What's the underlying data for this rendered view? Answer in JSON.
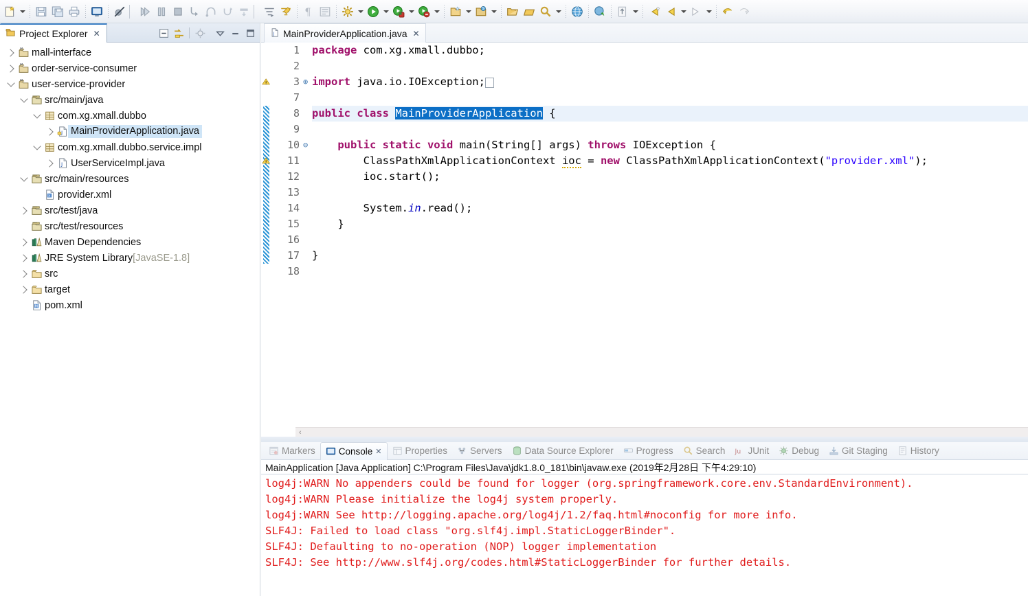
{
  "toolbar": {
    "groups": [
      {
        "name": "new",
        "icons": [
          "new-wizard-icon"
        ],
        "arrow": true
      },
      {
        "sep": true
      },
      {
        "name": "file",
        "icons": [
          "save-icon",
          "save-all-icon",
          "print-icon"
        ]
      },
      {
        "sep": true
      },
      {
        "name": "console-view",
        "icons": [
          "open-console-icon"
        ]
      },
      {
        "sep": true
      },
      {
        "name": "skip-breakpoints",
        "icons": [
          "skip-all-breakpoints-icon"
        ]
      },
      {
        "sep2": true
      },
      {
        "name": "debug-controls",
        "icons": [
          "resume-icon",
          "suspend-icon",
          "terminate-icon",
          "step-into-icon",
          "step-over-icon",
          "step-return-icon",
          "drop-to-frame-icon"
        ]
      },
      {
        "sep2": true
      },
      {
        "name": "step-filters",
        "icons": [
          "step-filters-icon",
          "use-step-filters-icon"
        ]
      },
      {
        "sep": true
      },
      {
        "name": "markers",
        "icons": [
          "pilcrow-icon",
          "show-whitespace-icon"
        ]
      },
      {
        "sep": true
      },
      {
        "name": "external-tools",
        "icons": [
          "external-tools-icon"
        ],
        "arrow": true
      },
      {
        "name": "run",
        "icons": [
          "run-icon"
        ],
        "arrow": true
      },
      {
        "name": "debug",
        "icons": [
          "debug-icon"
        ],
        "arrow": true
      },
      {
        "name": "coverage",
        "icons": [
          "coverage-icon"
        ],
        "arrow": true
      },
      {
        "sep": true
      },
      {
        "name": "new-java-package",
        "icons": [
          "new-java-package-icon"
        ],
        "arrow": true
      },
      {
        "name": "new-class",
        "icons": [
          "new-class-icon"
        ],
        "arrow": true
      },
      {
        "sep": true
      },
      {
        "name": "open-type",
        "icons": [
          "open-type-icon"
        ]
      },
      {
        "name": "open-task",
        "icons": [
          "open-task-icon"
        ]
      },
      {
        "name": "search",
        "icons": [
          "search-icon"
        ],
        "arrow": true
      },
      {
        "sep": true
      },
      {
        "name": "web-browser",
        "icons": [
          "web-browser-icon"
        ]
      },
      {
        "sep": true
      },
      {
        "name": "run-last-tool",
        "icons": [
          "run-last-tool-icon"
        ]
      },
      {
        "sep": true
      },
      {
        "name": "previous-annotation",
        "icons": [
          "previous-annotation-icon"
        ],
        "arrow": true
      },
      {
        "sep": true
      },
      {
        "name": "next-edit",
        "icons": [
          "next-edit-icon"
        ]
      },
      {
        "name": "back",
        "icons": [
          "back-icon"
        ],
        "arrow": true
      },
      {
        "name": "forward",
        "icons": [
          "forward-icon"
        ],
        "arrow": true
      },
      {
        "sep": true
      },
      {
        "name": "undo-nav",
        "icons": [
          "undo-nav-icon"
        ]
      },
      {
        "name": "redo-nav",
        "icons": [
          "redo-nav-icon"
        ]
      }
    ]
  },
  "explorer": {
    "tab_title": "Project Explorer",
    "close_glyph": "✕",
    "tools": [
      {
        "name": "collapse-all-icon",
        "title": "Collapse All"
      },
      {
        "name": "link-with-editor-icon",
        "title": "Link with Editor"
      },
      {
        "name": "focus-on-active-task-icon",
        "title": "Focus on Active Task"
      },
      {
        "name": "view-menu-icon",
        "title": "View Menu"
      },
      {
        "name": "minimize-icon",
        "title": "Minimize"
      },
      {
        "name": "maximize-icon",
        "title": "Maximize"
      }
    ],
    "tree": [
      {
        "label": "mall-interface",
        "indent": 0,
        "twist": "right",
        "icon": "maven-project-icon",
        "selected": false
      },
      {
        "label": "order-service-consumer",
        "indent": 0,
        "twist": "right",
        "icon": "maven-project-icon",
        "selected": false
      },
      {
        "label": "user-service-provider",
        "indent": 0,
        "twist": "down",
        "icon": "maven-project-icon",
        "selected": false
      },
      {
        "label": "src/main/java",
        "indent": 1,
        "twist": "down",
        "icon": "source-folder-icon",
        "selected": false
      },
      {
        "label": "com.xg.xmall.dubbo",
        "indent": 2,
        "twist": "down",
        "icon": "package-icon",
        "selected": false
      },
      {
        "label": "MainProviderApplication.java",
        "indent": 3,
        "twist": "right",
        "icon": "java-class-icon",
        "selected": true
      },
      {
        "label": "com.xg.xmall.dubbo.service.impl",
        "indent": 2,
        "twist": "down",
        "icon": "package-icon",
        "selected": false
      },
      {
        "label": "UserServiceImpl.java",
        "indent": 3,
        "twist": "right",
        "icon": "java-file-icon",
        "selected": false
      },
      {
        "label": "src/main/resources",
        "indent": 1,
        "twist": "down",
        "icon": "source-folder-icon",
        "selected": false
      },
      {
        "label": "provider.xml",
        "indent": 2,
        "twist": "none",
        "icon": "xml-file-icon",
        "selected": false
      },
      {
        "label": "src/test/java",
        "indent": 1,
        "twist": "right",
        "icon": "source-folder-icon",
        "selected": false
      },
      {
        "label": "src/test/resources",
        "indent": 1,
        "twist": "none",
        "icon": "source-folder-icon",
        "selected": false
      },
      {
        "label": "Maven Dependencies",
        "indent": 1,
        "twist": "right",
        "icon": "library-icon",
        "selected": false
      },
      {
        "label": "JRE System Library",
        "indent": 1,
        "twist": "right",
        "icon": "library-icon",
        "selected": false,
        "suffix": "[JavaSE-1.8]"
      },
      {
        "label": "src",
        "indent": 1,
        "twist": "right",
        "icon": "folder-icon",
        "selected": false
      },
      {
        "label": "target",
        "indent": 1,
        "twist": "right",
        "icon": "folder-icon",
        "selected": false
      },
      {
        "label": "pom.xml",
        "indent": 1,
        "twist": "none",
        "icon": "maven-pom-icon",
        "selected": false
      }
    ]
  },
  "editor": {
    "tab": {
      "title": "MainProviderApplication.java",
      "icon": "java-class-icon",
      "close_glyph": "✕",
      "dirty": false
    },
    "scroll_left_glyph": "‹",
    "lines": [
      {
        "num": "1",
        "fold": "",
        "marker": "",
        "changed": false,
        "highlight": false,
        "tokens": [
          {
            "t": "package ",
            "c": "kw"
          },
          {
            "t": "com.xg.xmall.dubbo;",
            "c": ""
          }
        ]
      },
      {
        "num": "2",
        "fold": "",
        "marker": "",
        "changed": false,
        "highlight": false,
        "tokens": []
      },
      {
        "num": "3",
        "fold": "⊕",
        "marker": "warning",
        "changed": false,
        "highlight": false,
        "tokens": [
          {
            "t": "import ",
            "c": "kw"
          },
          {
            "t": "java.io.IOException;",
            "c": ""
          },
          {
            "t": "▯",
            "c": "folded"
          }
        ]
      },
      {
        "num": "7",
        "fold": "",
        "marker": "",
        "changed": false,
        "highlight": false,
        "tokens": []
      },
      {
        "num": "8",
        "fold": "",
        "marker": "",
        "changed": true,
        "highlight": true,
        "tokens": [
          {
            "t": "public class ",
            "c": "kw"
          },
          {
            "t": "MainProviderApplication",
            "c": "sel"
          },
          {
            "t": " {",
            "c": ""
          }
        ]
      },
      {
        "num": "9",
        "fold": "",
        "marker": "",
        "changed": true,
        "highlight": false,
        "tokens": []
      },
      {
        "num": "10",
        "fold": "⊖",
        "marker": "",
        "changed": true,
        "highlight": false,
        "tokens": [
          {
            "t": "    public static void ",
            "c": "kw"
          },
          {
            "t": "main(String[] args) ",
            "c": ""
          },
          {
            "t": "throws ",
            "c": "kw"
          },
          {
            "t": "IOException {",
            "c": ""
          }
        ]
      },
      {
        "num": "11",
        "fold": "",
        "marker": "warning",
        "changed": true,
        "highlight": false,
        "tokens": [
          {
            "t": "        ClassPathXmlApplicationContext ",
            "c": ""
          },
          {
            "t": "ioc",
            "c": "warnu"
          },
          {
            "t": " = ",
            "c": ""
          },
          {
            "t": "new ",
            "c": "kw"
          },
          {
            "t": "ClassPathXmlApplicationContext(",
            "c": ""
          },
          {
            "t": "\"provider.xml\"",
            "c": "str"
          },
          {
            "t": ");",
            "c": ""
          }
        ]
      },
      {
        "num": "12",
        "fold": "",
        "marker": "",
        "changed": true,
        "highlight": false,
        "tokens": [
          {
            "t": "        ioc.start();",
            "c": ""
          }
        ]
      },
      {
        "num": "13",
        "fold": "",
        "marker": "",
        "changed": true,
        "highlight": false,
        "tokens": []
      },
      {
        "num": "14",
        "fold": "",
        "marker": "",
        "changed": true,
        "highlight": false,
        "tokens": [
          {
            "t": "        System.",
            "c": ""
          },
          {
            "t": "in",
            "c": "fld"
          },
          {
            "t": ".read();",
            "c": ""
          }
        ]
      },
      {
        "num": "15",
        "fold": "",
        "marker": "",
        "changed": true,
        "highlight": false,
        "tokens": [
          {
            "t": "    }",
            "c": ""
          }
        ]
      },
      {
        "num": "16",
        "fold": "",
        "marker": "",
        "changed": true,
        "highlight": false,
        "tokens": []
      },
      {
        "num": "17",
        "fold": "",
        "marker": "",
        "changed": true,
        "highlight": false,
        "tokens": [
          {
            "t": "}",
            "c": ""
          }
        ]
      },
      {
        "num": "18",
        "fold": "",
        "marker": "",
        "changed": false,
        "highlight": false,
        "tokens": []
      }
    ]
  },
  "bottom": {
    "tabs": [
      {
        "label": "Markers",
        "icon": "markers-icon",
        "active": false,
        "closable": false
      },
      {
        "label": "Console",
        "icon": "console-icon",
        "active": true,
        "closable": true
      },
      {
        "label": "Properties",
        "icon": "properties-icon",
        "active": false,
        "closable": false
      },
      {
        "label": "Servers",
        "icon": "servers-icon",
        "active": false,
        "closable": false
      },
      {
        "label": "Data Source Explorer",
        "icon": "datasource-icon",
        "active": false,
        "closable": false
      },
      {
        "label": "Progress",
        "icon": "progress-icon",
        "active": false,
        "closable": false
      },
      {
        "label": "Search",
        "icon": "search-icon",
        "active": false,
        "closable": false
      },
      {
        "label": "JUnit",
        "icon": "junit-icon",
        "active": false,
        "closable": false
      },
      {
        "label": "Debug",
        "icon": "debug-icon",
        "active": false,
        "closable": false
      },
      {
        "label": "Git Staging",
        "icon": "git-staging-icon",
        "active": false,
        "closable": false
      },
      {
        "label": "History",
        "icon": "history-icon",
        "active": false,
        "closable": false
      }
    ],
    "close_glyph": "✕",
    "console_header": "MainApplication [Java Application] C:\\Program Files\\Java\\jdk1.8.0_181\\bin\\javaw.exe (2019年2月28日 下午4:29:10)",
    "console_lines": [
      "log4j:WARN No appenders could be found for logger (org.springframework.core.env.StandardEnvironment).",
      "log4j:WARN Please initialize the log4j system properly.",
      "log4j:WARN See http://logging.apache.org/log4j/1.2/faq.html#noconfig for more info.",
      "SLF4J: Failed to load class \"org.slf4j.impl.StaticLoggerBinder\".",
      "SLF4J: Defaulting to no-operation (NOP) logger implementation",
      "SLF4J: See http://www.slf4j.org/codes.html#StaticLoggerBinder for further details."
    ],
    "console_text_color": "#e01b1b"
  }
}
